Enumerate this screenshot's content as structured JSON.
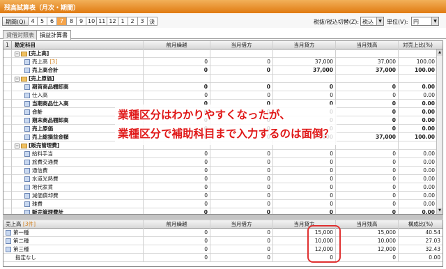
{
  "window": {
    "title": "残高試算表（月次・期間）"
  },
  "period": {
    "button_label": "期間(Q)",
    "months": [
      "4",
      "5",
      "6",
      "7",
      "8",
      "9",
      "10",
      "11",
      "12",
      "1",
      "2",
      "3",
      "決"
    ],
    "active_index": 3
  },
  "tax": {
    "label": "税抜/税込切替(Z):",
    "value": "税込"
  },
  "unit": {
    "label": "単位(V):",
    "value": "円"
  },
  "tabs": [
    {
      "label": "貸借対照表"
    },
    {
      "label": "損益計算書"
    }
  ],
  "main_table": {
    "headers": [
      "1",
      "勘定科目",
      "前月繰越",
      "当月借方",
      "当月貸方",
      "当月残高",
      "対売上比(%)"
    ],
    "rows": [
      {
        "name": "[売上高]",
        "type": "group",
        "values": [
          "",
          "",
          "",
          "",
          ""
        ]
      },
      {
        "name": "売上高",
        "code": "[3]",
        "type": "acct",
        "values": [
          "0",
          "0",
          "37,000",
          "37,000",
          "100.00"
        ]
      },
      {
        "name": "売上高合計",
        "type": "total",
        "values": [
          "0",
          "0",
          "37,000",
          "37,000",
          "100.00"
        ]
      },
      {
        "name": "[売上原価]",
        "type": "group",
        "values": [
          "",
          "",
          "",
          "",
          ""
        ]
      },
      {
        "name": "期首商品棚卸高",
        "type": "total",
        "values": [
          "0",
          "0",
          "0",
          "0",
          "0.00"
        ]
      },
      {
        "name": "仕入高",
        "type": "acct",
        "values": [
          "0",
          "0",
          "0",
          "0",
          "0.00"
        ]
      },
      {
        "name": "当期商品仕入高",
        "type": "total",
        "values": [
          "0",
          "0",
          "0",
          "0",
          "0.00"
        ]
      },
      {
        "name": "合計",
        "type": "total",
        "values": [
          "0",
          "0",
          "0",
          "0",
          "0.00"
        ]
      },
      {
        "name": "期末商品棚卸高",
        "type": "total",
        "values": [
          "0",
          "0",
          "0",
          "0",
          "0.00"
        ]
      },
      {
        "name": "売上原価",
        "type": "total",
        "values": [
          "0",
          "0",
          "0",
          "0",
          "0.00"
        ]
      },
      {
        "name": "売上総損益金額",
        "type": "total",
        "values": [
          "0",
          "0",
          "37,000",
          "37,000",
          "100.00"
        ]
      },
      {
        "name": "[販売管理費]",
        "type": "group",
        "values": [
          "",
          "",
          "",
          "",
          ""
        ]
      },
      {
        "name": "給料手当",
        "type": "acct",
        "values": [
          "0",
          "0",
          "0",
          "0",
          "0.00"
        ]
      },
      {
        "name": "旅費交通費",
        "type": "acct",
        "values": [
          "0",
          "0",
          "0",
          "0",
          "0.00"
        ]
      },
      {
        "name": "通信費",
        "type": "acct",
        "values": [
          "0",
          "0",
          "0",
          "0",
          "0.00"
        ]
      },
      {
        "name": "水道光熱費",
        "type": "acct",
        "values": [
          "0",
          "0",
          "0",
          "0",
          "0.00"
        ]
      },
      {
        "name": "地代家賃",
        "type": "acct",
        "values": [
          "0",
          "0",
          "0",
          "0",
          "0.00"
        ]
      },
      {
        "name": "減価償却費",
        "type": "acct",
        "values": [
          "0",
          "0",
          "0",
          "0",
          "0.00"
        ]
      },
      {
        "name": "雑費",
        "type": "acct",
        "values": [
          "0",
          "0",
          "0",
          "0",
          "0.00"
        ]
      },
      {
        "name": "販売管理費計",
        "type": "total",
        "values": [
          "0",
          "0",
          "0",
          "0",
          "0.00"
        ]
      }
    ]
  },
  "sub_table": {
    "title": "売上高",
    "count": "[3件]",
    "headers": [
      "前月繰越",
      "当月借方",
      "当月貸方",
      "当月残高",
      "構成比(%)"
    ],
    "rows": [
      {
        "name": "第一種",
        "values": [
          "0",
          "0",
          "15,000",
          "15,000",
          "40.54"
        ]
      },
      {
        "name": "第二種",
        "values": [
          "0",
          "0",
          "10,000",
          "10,000",
          "27.03"
        ]
      },
      {
        "name": "第三種",
        "values": [
          "0",
          "0",
          "12,000",
          "12,000",
          "32.43"
        ]
      },
      {
        "name": "指定なし",
        "values": [
          "0",
          "0",
          "0",
          "0",
          "0.00"
        ]
      }
    ]
  },
  "annotation": {
    "line1": "業種区分はわかりやすくなったが、",
    "line2": "業種区分で補助科目まで入力するのは面倒？"
  }
}
